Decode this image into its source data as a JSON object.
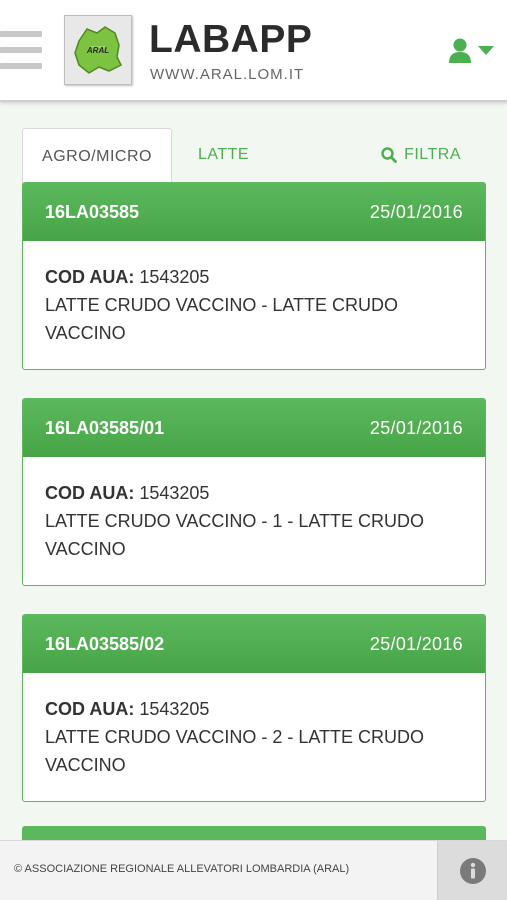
{
  "header": {
    "title": "LABAPP",
    "url": "WWW.ARAL.LOM.IT",
    "logo_text": "ARAL",
    "menu_icon": "hamburger-icon",
    "user_icon": "user-icon"
  },
  "tabs": [
    {
      "label": "AGRO/MICRO",
      "active": true
    },
    {
      "label": "LATTE",
      "active": false
    }
  ],
  "filter": {
    "label": "FILTRA",
    "icon": "search-icon"
  },
  "cards": [
    {
      "code": "16LA03585",
      "date": "25/01/2016",
      "cod_label": "COD AUA:",
      "cod_value": "1543205",
      "description": "LATTE CRUDO VACCINO - LATTE CRUDO VACCINO"
    },
    {
      "code": "16LA03585/01",
      "date": "25/01/2016",
      "cod_label": "COD AUA:",
      "cod_value": "1543205",
      "description": "LATTE CRUDO VACCINO - 1 - LATTE CRUDO VACCINO"
    },
    {
      "code": "16LA03585/02",
      "date": "25/01/2016",
      "cod_label": "COD AUA:",
      "cod_value": "1543205",
      "description": "LATTE CRUDO VACCINO - 2 - LATTE CRUDO VACCINO"
    }
  ],
  "footer": {
    "text": "© ASSOCIAZIONE REGIONALE ALLEVATORI LOMBARDIA (ARAL)",
    "info_icon": "info-icon"
  },
  "colors": {
    "accent": "#5cb85c",
    "accent_dark": "#47a447",
    "background": "#f2f8f1"
  }
}
